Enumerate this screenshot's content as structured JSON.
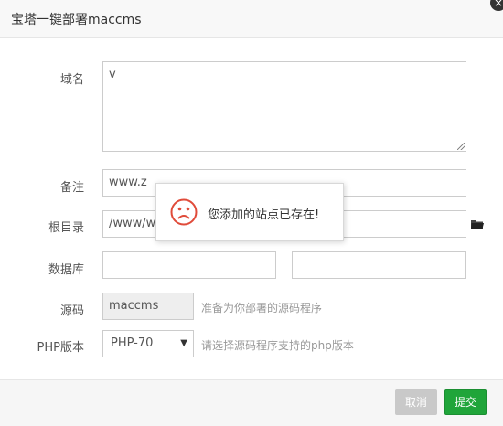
{
  "dialog": {
    "title": "宝塔一键部署maccms",
    "close_glyph": "×"
  },
  "form": {
    "domain_label": "域名",
    "domain_value": "v",
    "remark_label": "备注",
    "remark_value": "www.z",
    "root_label": "根目录",
    "root_value": "/www/wv",
    "database_label": "数据库",
    "db_name_value": "",
    "db_pass_value": "",
    "source_label": "源码",
    "source_value": "maccms",
    "source_hint": "准备为你部署的源码程序",
    "php_label": "PHP版本",
    "php_selected": "PHP-70",
    "php_hint": "请选择源码程序支持的php版本"
  },
  "buttons": {
    "cancel": "取消",
    "submit": "提交"
  },
  "toast": {
    "message": "您添加的站点已存在!",
    "icon_color": "#e04b3a"
  },
  "colors": {
    "accent": "#20a53a",
    "cancel": "#c9c9c9"
  },
  "icons": {
    "folder": "folder-icon",
    "sad_face": "sad-face-icon",
    "close": "close-icon"
  }
}
